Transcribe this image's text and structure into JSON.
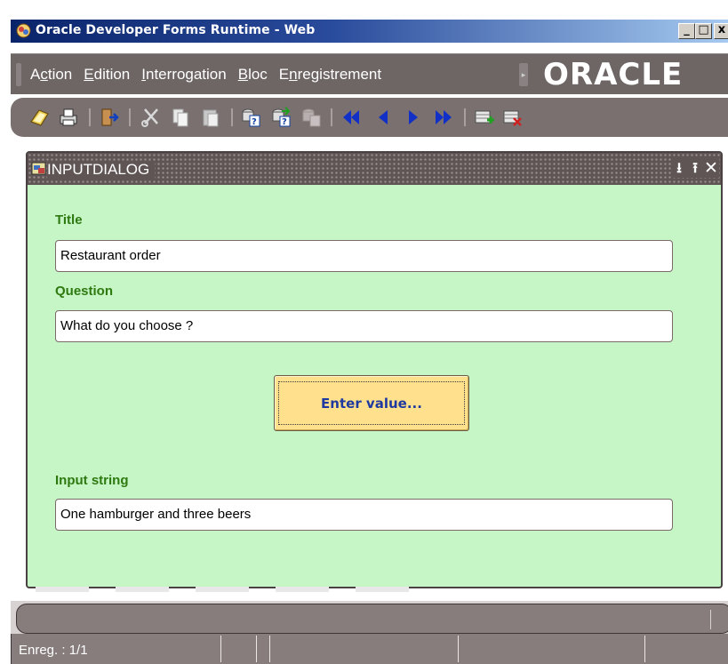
{
  "window": {
    "title": "Oracle Developer Forms Runtime - Web",
    "icon": "oracle-forms-app-icon",
    "controls": {
      "minimize": "_",
      "maximize": "□",
      "close": "x"
    }
  },
  "menu": {
    "items": [
      {
        "pre": "A",
        "mnemonic": "c",
        "post": "tion",
        "label": "Action"
      },
      {
        "pre": "",
        "mnemonic": "E",
        "post": "dition",
        "label": "Edition"
      },
      {
        "pre": "",
        "mnemonic": "I",
        "post": "nterrogation",
        "label": "Interrogation"
      },
      {
        "pre": "",
        "mnemonic": "B",
        "post": "loc",
        "label": "Bloc"
      },
      {
        "pre": "E",
        "mnemonic": "n",
        "post": "registrement",
        "label": "Enregistrement"
      }
    ],
    "logo": "ORACLE"
  },
  "toolbar": {
    "buttons": [
      "save-icon",
      "print-icon",
      "exit-icon",
      "cut-icon",
      "copy-icon",
      "paste-icon",
      "enter-query-icon",
      "execute-query-icon",
      "cancel-query-icon",
      "first-record-icon",
      "previous-record-icon",
      "next-record-icon",
      "last-record-icon",
      "insert-record-icon",
      "delete-record-icon"
    ]
  },
  "dialog": {
    "title": "INPUTDIALOG",
    "fields": {
      "title_label": "Title",
      "title_value": "Restaurant order",
      "question_label": "Question",
      "question_value": "What do you choose ?",
      "input_label": "Input string",
      "input_value": "One hamburger and three beers"
    },
    "button_label": "Enter value..."
  },
  "status": {
    "record": "Enreg. : 1/1"
  },
  "colors": {
    "dialog_bg": "#c6f5c6",
    "label_green": "#2e7a10",
    "button_yellow": "#ffe08c",
    "chrome_brown": "#6e6565",
    "titlebar_blue": "#0a246a"
  }
}
